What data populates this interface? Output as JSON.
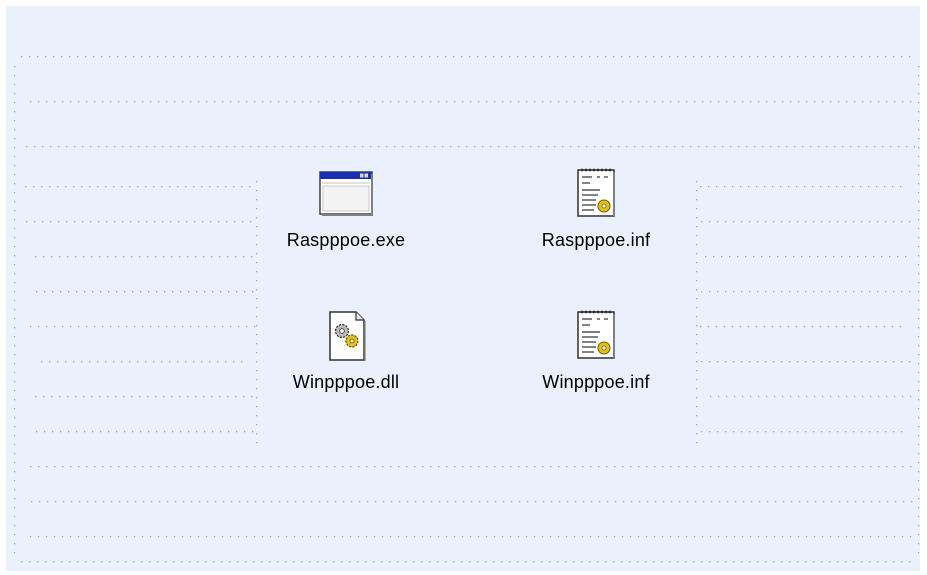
{
  "files": [
    {
      "name": "Raspppoe.exe",
      "icon": "application-window-icon"
    },
    {
      "name": "Raspppoe.inf",
      "icon": "setup-information-icon"
    },
    {
      "name": "Winpppoe.dll",
      "icon": "dll-gears-icon"
    },
    {
      "name": "Winpppoe.inf",
      "icon": "setup-information-icon"
    }
  ],
  "colors": {
    "background": "#eaf1fc",
    "dots": "#9aa6bd",
    "titlebar": "#1c2fb0"
  }
}
